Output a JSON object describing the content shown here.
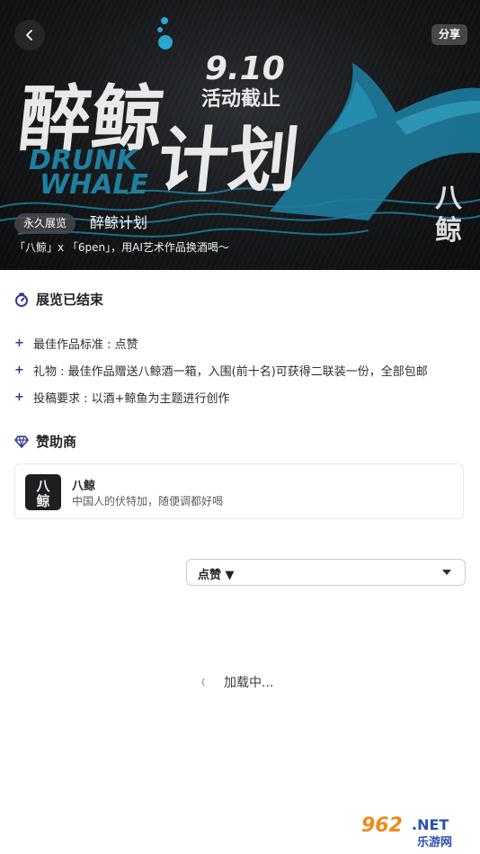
{
  "header": {
    "share_label": "分享"
  },
  "banner": {
    "title_cn": "醉鲸",
    "title_cn_2": "计划",
    "title_en_1": "DRUNK",
    "title_en_2": "WHALE",
    "date": "9.10",
    "deadline": "活动截止",
    "tag": "永久展览",
    "name": "醉鲸计划",
    "subtitle": "「八鲸」x 「6pen」，用AI艺术作品换酒喝〜",
    "brand_mark": "八鲸"
  },
  "status": {
    "title": "展览已结束"
  },
  "rules": [
    {
      "text": "最佳作品标准 : 点赞"
    },
    {
      "text": "礼物 : 最佳作品赠送八鲸酒一箱，入围(前十名)可获得二联装一份，全部包邮"
    },
    {
      "text": "投稿要求 : 以酒+鲸鱼为主题进行创作"
    }
  ],
  "sponsor_section": {
    "title": "赞助商"
  },
  "sponsor": {
    "name": "八鲸",
    "description": "中国人的伏特加，随便调都好喝",
    "logo_text": "八鲸"
  },
  "sort": {
    "selected": "点赞 ▼"
  },
  "loading": {
    "text": "加载中..."
  },
  "watermark": {
    "number": "962",
    "suffix": ".NET",
    "site": "乐游网"
  },
  "colors": {
    "accent_blue": "#2f3b8f",
    "whale_teal": "#1e7fa0",
    "banner_bg": "#141618"
  }
}
